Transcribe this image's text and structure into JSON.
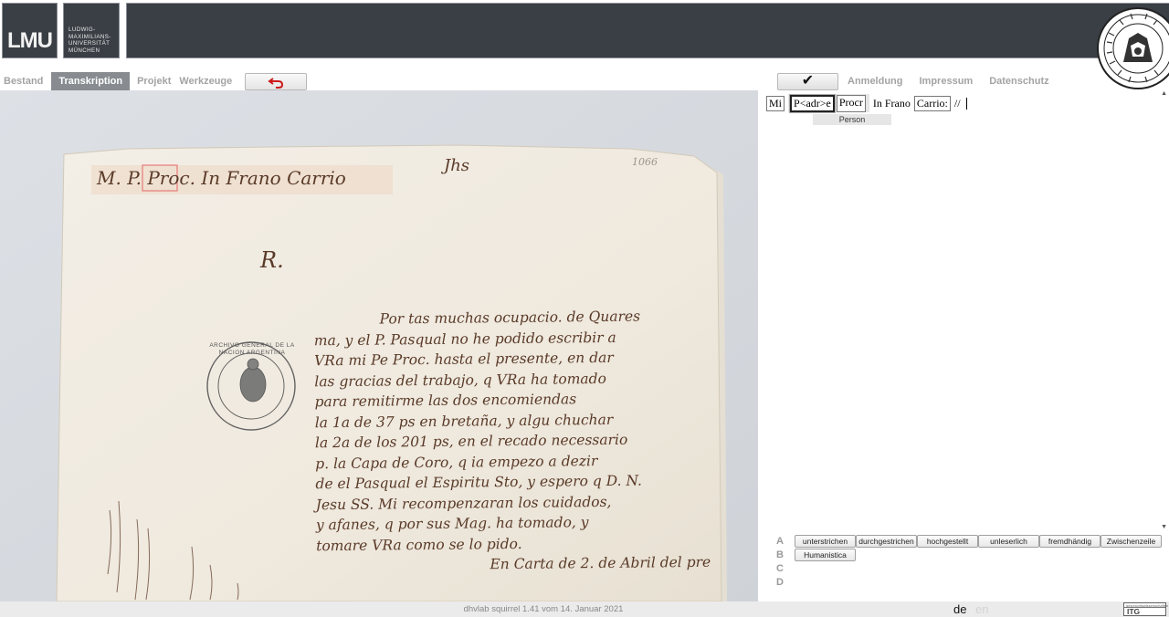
{
  "header": {
    "logo_text": "LMU",
    "university_lines": [
      "LUDWIG-",
      "MAXIMILIANS-",
      "UNIVERSITÄT",
      "MÜNCHEN"
    ]
  },
  "nav": {
    "tabs": [
      {
        "label": "Bestand",
        "active": false
      },
      {
        "label": "Transkription",
        "active": true
      },
      {
        "label": "Projekt",
        "active": false
      },
      {
        "label": "Werkzeuge",
        "active": false
      }
    ],
    "undo_icon": "undo-arrow-icon",
    "confirm_icon": "checkmark-icon",
    "confirm_label": "✔",
    "links": [
      "Anmeldung",
      "Impressum",
      "Datenschutz"
    ]
  },
  "document": {
    "page_number": "1066",
    "heading_line": "M. P. Proc. In Frano Carrio",
    "sigil": "Jhs",
    "salutation": "R.",
    "stamp_text": "ARCHIVO GENERAL DE LA NACION ARGENTINA",
    "body_lines": [
      "Por tas muchas ocupacio. de Quares",
      "ma, y el P. Pasqual no he podido escribir a",
      "VRa mi Pe Proc. hasta el presente, en dar",
      "las gracias del trabajo, q VRa ha tomado",
      "para remitirme las dos encomiendas",
      "la 1a de 37 ps en bretaña, y algu chuchar",
      "la 2a de los 201 ps, en el recado necessario",
      "p. la Capa de Coro, q ia empezo a dezir",
      "de el Pasqual el Espiritu Sto, y espero q D. N.",
      "Jesu SS. Mi recompenzaran los cuidados,",
      "y afanes, q por sus Mag. ha tomado, y",
      "tomare VRa como se lo pido.",
      "En Carta de 2. de Abril del pre"
    ]
  },
  "transcription": {
    "tokens": [
      {
        "text": "Mi",
        "type": "box"
      },
      {
        "text": "P<adr>e",
        "type": "selected"
      },
      {
        "text": "Procr",
        "type": "box"
      },
      {
        "text": "In Frano",
        "type": "plain"
      },
      {
        "text": "Carrio:",
        "type": "box"
      },
      {
        "text": "//",
        "type": "plain"
      }
    ],
    "annotation_label": "Person"
  },
  "toolbar": {
    "rows": [
      {
        "label": "A",
        "buttons": [
          "unterstrichen",
          "durchgestrichen",
          "hochgestellt",
          "unleserlich",
          "fremdhändig",
          "Zwischenzeile"
        ]
      },
      {
        "label": "B",
        "buttons": [
          "Humanistica"
        ]
      },
      {
        "label": "C",
        "buttons": []
      },
      {
        "label": "D",
        "buttons": []
      }
    ]
  },
  "footer": {
    "version": "dhvlab squirrel 1.41 vom 14. Januar 2021",
    "lang_de": "de",
    "lang_en": "en",
    "partner_logo_text": "ITG",
    "partner_logo_top": "geschichtswissenschaften"
  },
  "colors": {
    "header_bg": "#3a3f45",
    "active_tab": "#888c90",
    "inactive_text": "#a3a3a3",
    "paper": "#f1ebe0",
    "ink": "#5a3a28",
    "undo_arrow": "#cc1b1b"
  }
}
